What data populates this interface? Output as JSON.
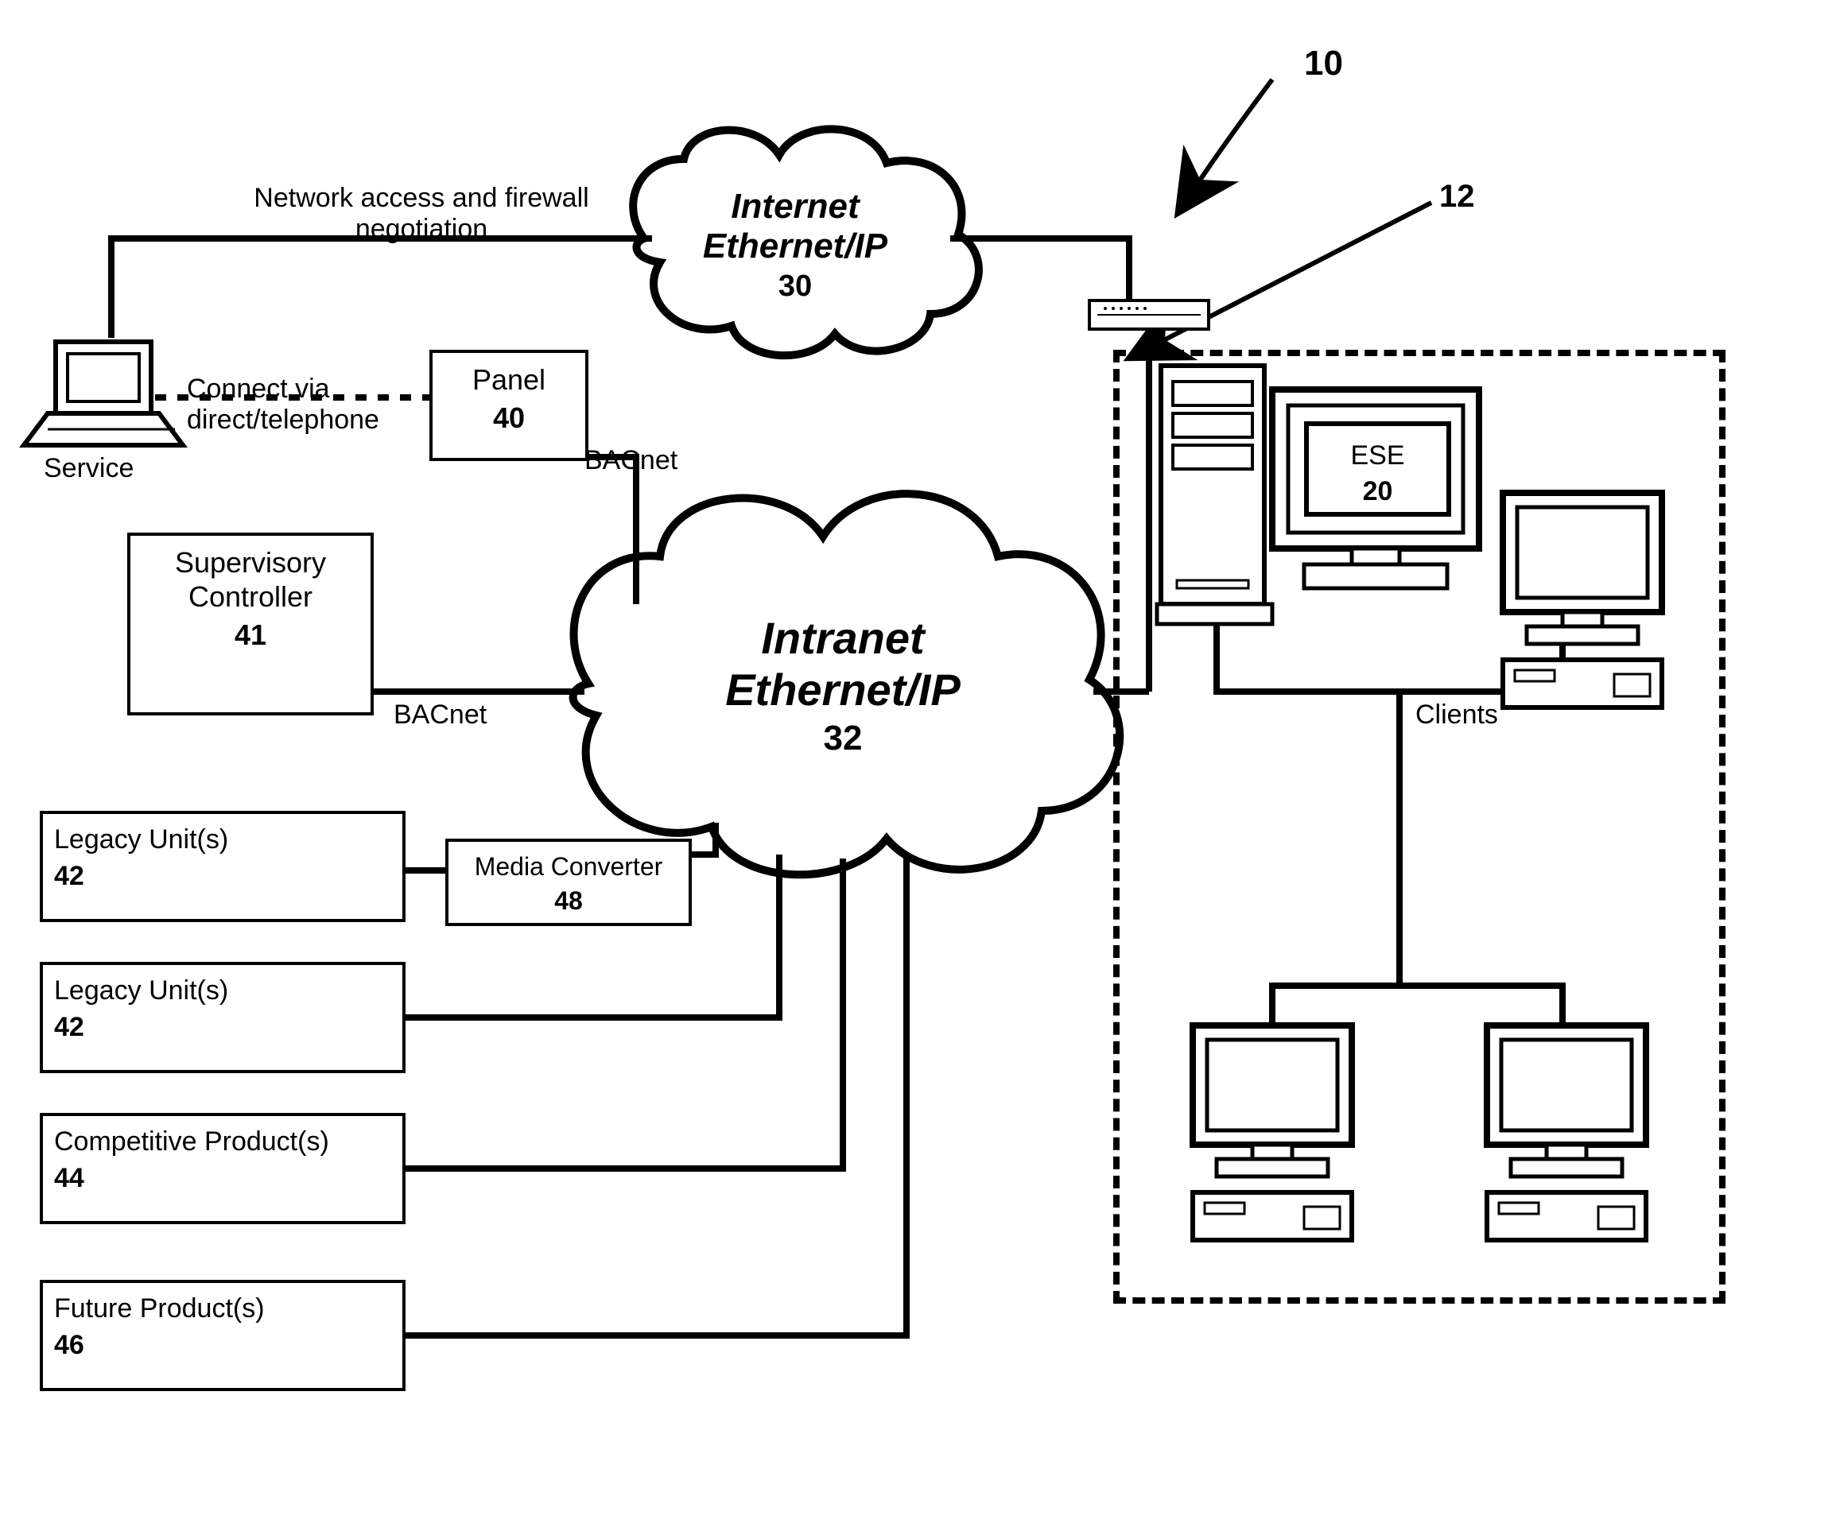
{
  "figure_ref": "10",
  "area_ref": "12",
  "annotations": {
    "network_access": "Network access and firewall\nnegotiation",
    "connect": "Connect via\ndirect/telephone",
    "service": "Service",
    "clients": "Clients",
    "bacnet": "BACnet"
  },
  "clouds": {
    "internet": {
      "line1": "Internet",
      "line2": "Ethernet/IP",
      "num": "30"
    },
    "intranet": {
      "line1": "Intranet",
      "line2": "Ethernet/IP",
      "num": "32"
    }
  },
  "boxes": {
    "panel": {
      "title": "Panel",
      "num": "40"
    },
    "supervisory": {
      "title": "Supervisory\nController",
      "num": "41"
    },
    "legacy1": {
      "title": "Legacy Unit(s)",
      "num": "42"
    },
    "media": {
      "title": "Media Converter",
      "num": "48"
    },
    "legacy2": {
      "title": "Legacy Unit(s)",
      "num": "42"
    },
    "competitive": {
      "title": "Competitive Product(s)",
      "num": "44"
    },
    "future": {
      "title": "Future Product(s)",
      "num": "46"
    }
  },
  "ese": {
    "title": "ESE",
    "num": "20"
  }
}
